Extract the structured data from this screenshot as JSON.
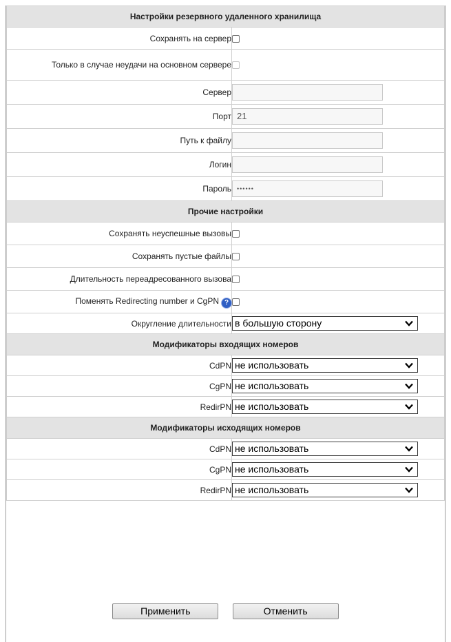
{
  "backup_storage": {
    "section_title": "Настройки резервного удаленного хранилища",
    "save_to_server": "Сохранять на сервер",
    "only_on_failure": "Только в случае неудачи на основном сервере",
    "server": {
      "label": "Сервер",
      "value": ""
    },
    "port": {
      "label": "Порт",
      "value": "21"
    },
    "file_path": {
      "label": "Путь к файлу",
      "value": ""
    },
    "login": {
      "label": "Логин",
      "value": ""
    },
    "password": {
      "label": "Пароль",
      "value": "••••••"
    }
  },
  "other_settings": {
    "section_title": "Прочие настройки",
    "save_failed_calls": "Сохранять неуспешные вызовы",
    "save_empty_files": "Сохранять пустые файлы",
    "redirected_call_duration": "Длительность переадресованного вызова",
    "swap_redirecting_cgpn": "Поменять Redirecting number и CgPN",
    "duration_rounding": {
      "label": "Округление длительности",
      "value": "в большую сторону"
    }
  },
  "incoming_modifiers": {
    "section_title": "Модификаторы входящих номеров",
    "cdpn": {
      "label": "CdPN",
      "value": "не использовать"
    },
    "cgpn": {
      "label": "CgPN",
      "value": "не использовать"
    },
    "redirpn": {
      "label": "RedirPN",
      "value": "не использовать"
    }
  },
  "outgoing_modifiers": {
    "section_title": "Модификаторы исходящих номеров",
    "cdpn": {
      "label": "CdPN",
      "value": "не использовать"
    },
    "cgpn": {
      "label": "CgPN",
      "value": "не использовать"
    },
    "redirpn": {
      "label": "RedirPN",
      "value": "не использовать"
    }
  },
  "actions": {
    "apply": "Применить",
    "cancel": "Отменить"
  },
  "icons": {
    "help": "help-icon",
    "dropdown": "chevron-down-icon"
  },
  "colors": {
    "section_bg": "#e3e3e3",
    "help_icon": "#2f5fc4"
  }
}
